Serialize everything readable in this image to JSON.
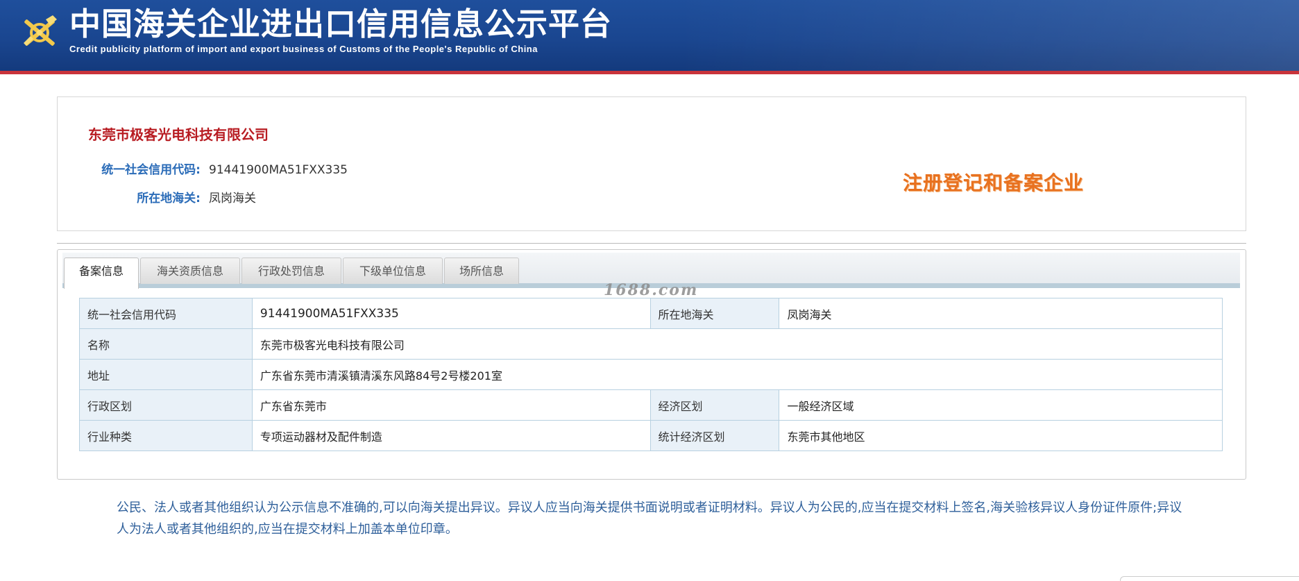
{
  "header": {
    "title": "中国海关企业进出口信用信息公示平台",
    "subtitle": "Credit publicity platform of import and export business of Customs of the People's Republic of China",
    "logo_icon": "customs-emblem-icon"
  },
  "company": {
    "name": "东莞市极客光电科技有限公司",
    "credit_code_label": "统一社会信用代码:",
    "credit_code": "91441900MA51FXX335",
    "customs_label": "所在地海关:",
    "customs": "凤岗海关",
    "stamp": "注册登记和备案企业"
  },
  "tabs": [
    {
      "label": "备案信息",
      "active": true
    },
    {
      "label": "海关资质信息",
      "active": false
    },
    {
      "label": "行政处罚信息",
      "active": false
    },
    {
      "label": "下级单位信息",
      "active": false
    },
    {
      "label": "场所信息",
      "active": false
    }
  ],
  "watermark": "1688.com",
  "table": {
    "row1": {
      "l1": "统一社会信用代码",
      "v1": "91441900MA51FXX335",
      "l2": "所在地海关",
      "v2": "凤岗海关"
    },
    "row2": {
      "l1": "名称",
      "v1": "东莞市极客光电科技有限公司"
    },
    "row3": {
      "l1": "地址",
      "v1": "广东省东莞市清溪镇清溪东风路84号2号楼201室"
    },
    "row4": {
      "l1": "行政区划",
      "v1": "广东省东莞市",
      "l2": "经济区划",
      "v2": "一般经济区域"
    },
    "row5": {
      "l1": "行业种类",
      "v1": "专项运动器材及配件制造",
      "l2": "统计经济区划",
      "v2": "东莞市其他地区"
    }
  },
  "notice": "公民、法人或者其他组织认为公示信息不准确的,可以向海关提出异议。异议人应当向海关提供书面说明或者证明材料。异议人为公民的,应当在提交材料上签名,海关验核异议人身份证件原件;异议人为法人或者其他组织的,应当在提交材料上加盖本单位印章。",
  "colors": {
    "header_blue": "#1a4690",
    "header_red_line": "#c9343b",
    "company_name_red": "#b81c22",
    "label_blue": "#2b6cb8",
    "stamp_orange": "#e8711f",
    "table_label_bg": "#e9f1f8",
    "table_border": "#b7d0e0",
    "notice_blue": "#2e5f9a"
  }
}
